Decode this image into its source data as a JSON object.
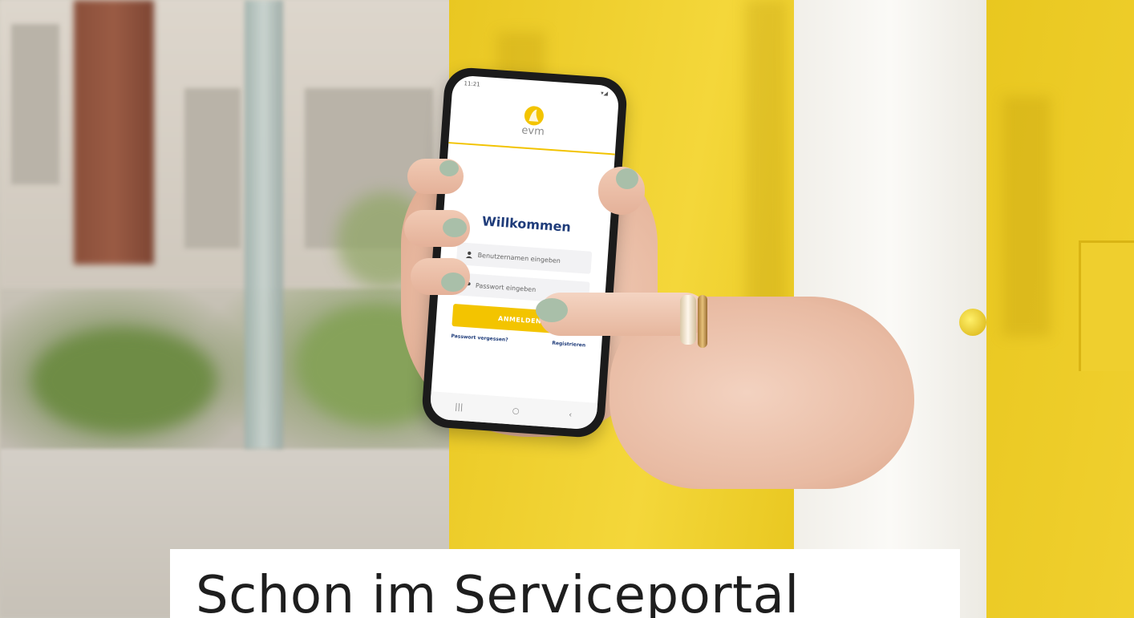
{
  "phone_app": {
    "status_time": "11:21",
    "logo_text": "evm",
    "title": "Willkommen",
    "username_placeholder": "Benutzernamen eingeben",
    "password_placeholder": "Passwort eingeben",
    "login_button": "ANMELDEN",
    "forgot_password": "Passwort vergessen?",
    "register": "Registrieren",
    "nav_recent": "|||",
    "nav_home": "○",
    "nav_back": "‹",
    "icons": {
      "user": "user-icon",
      "key": "key-icon"
    },
    "colors": {
      "accent": "#f3c400",
      "title": "#1f3c7a"
    }
  },
  "caption": {
    "title": "Schon im Serviceportal"
  }
}
